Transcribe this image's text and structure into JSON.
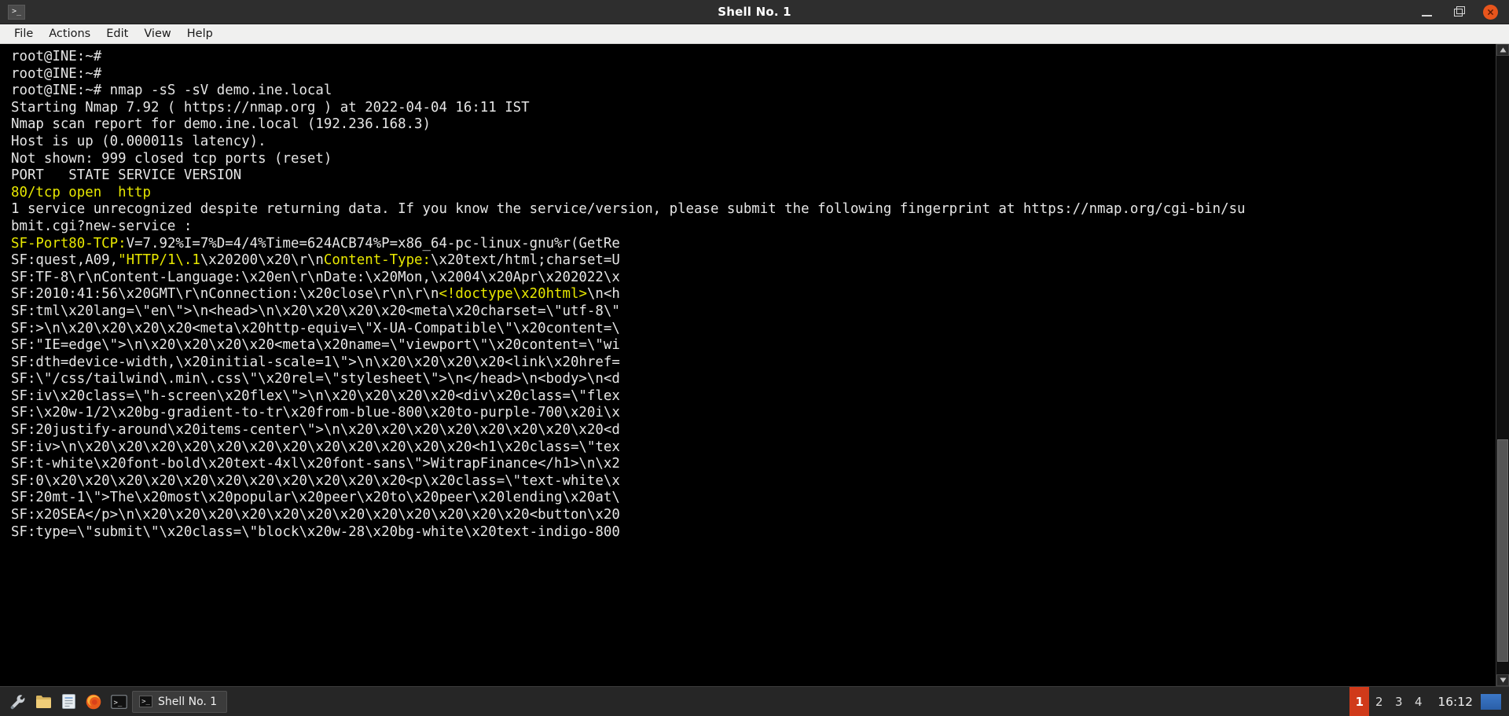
{
  "window": {
    "title": "Shell No. 1",
    "app_icon": ">_",
    "controls": {
      "minimize": "minimize-icon",
      "maximize": "maximize-icon",
      "close": "close-icon"
    }
  },
  "menubar": {
    "items": [
      {
        "label": "File"
      },
      {
        "label": "Actions"
      },
      {
        "label": "Edit"
      },
      {
        "label": "View"
      },
      {
        "label": "Help"
      }
    ]
  },
  "terminal": {
    "lines": [
      {
        "segments": [
          {
            "text": "root@INE:~#",
            "color": "default"
          }
        ]
      },
      {
        "segments": [
          {
            "text": "root@INE:~#",
            "color": "default"
          }
        ]
      },
      {
        "segments": [
          {
            "text": "root@INE:~# nmap -sS -sV demo.ine.local",
            "color": "default"
          }
        ]
      },
      {
        "segments": [
          {
            "text": "Starting Nmap 7.92 ( https://nmap.org ) at 2022-04-04 16:11 IST",
            "color": "default"
          }
        ]
      },
      {
        "segments": [
          {
            "text": "Nmap scan report for demo.ine.local (192.236.168.3)",
            "color": "default"
          }
        ]
      },
      {
        "segments": [
          {
            "text": "Host is up (0.000011s latency).",
            "color": "default"
          }
        ]
      },
      {
        "segments": [
          {
            "text": "Not shown: 999 closed tcp ports (reset)",
            "color": "default"
          }
        ]
      },
      {
        "segments": [
          {
            "text": "PORT   STATE SERVICE VERSION",
            "color": "default"
          }
        ]
      },
      {
        "segments": [
          {
            "text": "80/tcp open  http",
            "color": "yellow"
          }
        ]
      },
      {
        "segments": [
          {
            "text": "1 service unrecognized despite returning data. If you know the service/version, please submit the following fingerprint at https://nmap.org/cgi-bin/su",
            "color": "default"
          }
        ]
      },
      {
        "segments": [
          {
            "text": "bmit.cgi?new-service :",
            "color": "default"
          }
        ]
      },
      {
        "segments": [
          {
            "text": "SF-Port80-TCP:",
            "color": "yellow"
          },
          {
            "text": "V=7.92%I=7%D=4/4%Time=624ACB74%P=x86_64-pc-linux-gnu%r(GetRe",
            "color": "default"
          }
        ]
      },
      {
        "segments": [
          {
            "text": "SF:quest,A09,",
            "color": "default"
          },
          {
            "text": "\"HTTP/1\\.1",
            "color": "yellow"
          },
          {
            "text": "\\x20200\\x20\\r\\n",
            "color": "default"
          },
          {
            "text": "Content-Type:",
            "color": "yellow"
          },
          {
            "text": "\\x20text/html;charset=U",
            "color": "default"
          }
        ]
      },
      {
        "segments": [
          {
            "text": "SF:TF-8\\r\\nContent-Language:\\x20en\\r\\nDate:\\x20Mon,\\x2004\\x20Apr\\x202022\\x",
            "color": "default"
          }
        ]
      },
      {
        "segments": [
          {
            "text": "SF:2010:41:56\\x20GMT\\r\\nConnection:\\x20close\\r\\n\\r\\n",
            "color": "default"
          },
          {
            "text": "<!doctype\\x20html>",
            "color": "yellow"
          },
          {
            "text": "\\n<h",
            "color": "default"
          }
        ]
      },
      {
        "segments": [
          {
            "text": "SF:tml\\x20lang=\\\"en\\\">\\n<head>\\n\\x20\\x20\\x20\\x20<meta\\x20charset=\\\"utf-8\\\"",
            "color": "default"
          }
        ]
      },
      {
        "segments": [
          {
            "text": "SF:>\\n\\x20\\x20\\x20\\x20<meta\\x20http-equiv=\\\"X-UA-Compatible\\\"\\x20content=\\",
            "color": "default"
          }
        ]
      },
      {
        "segments": [
          {
            "text": "SF:\"IE=edge\\\">\\n\\x20\\x20\\x20\\x20<meta\\x20name=\\\"viewport\\\"\\x20content=\\\"wi",
            "color": "default"
          }
        ]
      },
      {
        "segments": [
          {
            "text": "SF:dth=device-width,\\x20initial-scale=1\\\">\\n\\x20\\x20\\x20\\x20<link\\x20href=",
            "color": "default"
          }
        ]
      },
      {
        "segments": [
          {
            "text": "SF:\\\"/css/tailwind\\.min\\.css\\\"\\x20rel=\\\"stylesheet\\\">\\n</head>\\n<body>\\n<d",
            "color": "default"
          }
        ]
      },
      {
        "segments": [
          {
            "text": "SF:iv\\x20class=\\\"h-screen\\x20flex\\\">\\n\\x20\\x20\\x20\\x20<div\\x20class=\\\"flex",
            "color": "default"
          }
        ]
      },
      {
        "segments": [
          {
            "text": "SF:\\x20w-1/2\\x20bg-gradient-to-tr\\x20from-blue-800\\x20to-purple-700\\x20i\\x",
            "color": "default"
          }
        ]
      },
      {
        "segments": [
          {
            "text": "SF:20justify-around\\x20items-center\\\">\\n\\x20\\x20\\x20\\x20\\x20\\x20\\x20\\x20<d",
            "color": "default"
          }
        ]
      },
      {
        "segments": [
          {
            "text": "SF:iv>\\n\\x20\\x20\\x20\\x20\\x20\\x20\\x20\\x20\\x20\\x20\\x20\\x20<h1\\x20class=\\\"tex",
            "color": "default"
          }
        ]
      },
      {
        "segments": [
          {
            "text": "SF:t-white\\x20font-bold\\x20text-4xl\\x20font-sans\\\">WitrapFinance</h1>\\n\\x2",
            "color": "default"
          }
        ]
      },
      {
        "segments": [
          {
            "text": "SF:0\\x20\\x20\\x20\\x20\\x20\\x20\\x20\\x20\\x20\\x20\\x20<p\\x20class=\\\"text-white\\x",
            "color": "default"
          }
        ]
      },
      {
        "segments": [
          {
            "text": "SF:20mt-1\\\">The\\x20most\\x20popular\\x20peer\\x20to\\x20peer\\x20lending\\x20at\\",
            "color": "default"
          }
        ]
      },
      {
        "segments": [
          {
            "text": "SF:x20SEA</p>\\n\\x20\\x20\\x20\\x20\\x20\\x20\\x20\\x20\\x20\\x20\\x20\\x20<button\\x20",
            "color": "default"
          }
        ]
      },
      {
        "segments": [
          {
            "text": "SF:type=\\\"submit\\\"\\x20class=\\\"block\\x20w-28\\x20bg-white\\x20text-indigo-800",
            "color": "default"
          }
        ]
      }
    ]
  },
  "taskbar": {
    "tray_icons": [
      {
        "name": "wrench-icon",
        "glyph": "🔧"
      },
      {
        "name": "files-icon",
        "glyph": "🗂"
      },
      {
        "name": "text-editor-icon",
        "glyph": "📝"
      },
      {
        "name": "firefox-icon",
        "glyph": "🔥"
      },
      {
        "name": "terminal-icon",
        "glyph": ">_"
      }
    ],
    "window_button": {
      "icon": ">_",
      "label": "Shell No. 1"
    },
    "desktops": [
      {
        "label": "1",
        "active": true
      },
      {
        "label": "2",
        "active": false
      },
      {
        "label": "3",
        "active": false
      },
      {
        "label": "4",
        "active": false
      }
    ],
    "clock": "16:12"
  },
  "colors": {
    "terminal_bg": "#000000",
    "terminal_fg": "#e6e6e6",
    "terminal_yellow": "#e8e800",
    "titlebar_bg": "#2e2e2e",
    "menubar_bg": "#f0f0ef",
    "taskbar_bg": "#262626",
    "close_button": "#e8551c",
    "active_desktop": "#d03a1a"
  }
}
